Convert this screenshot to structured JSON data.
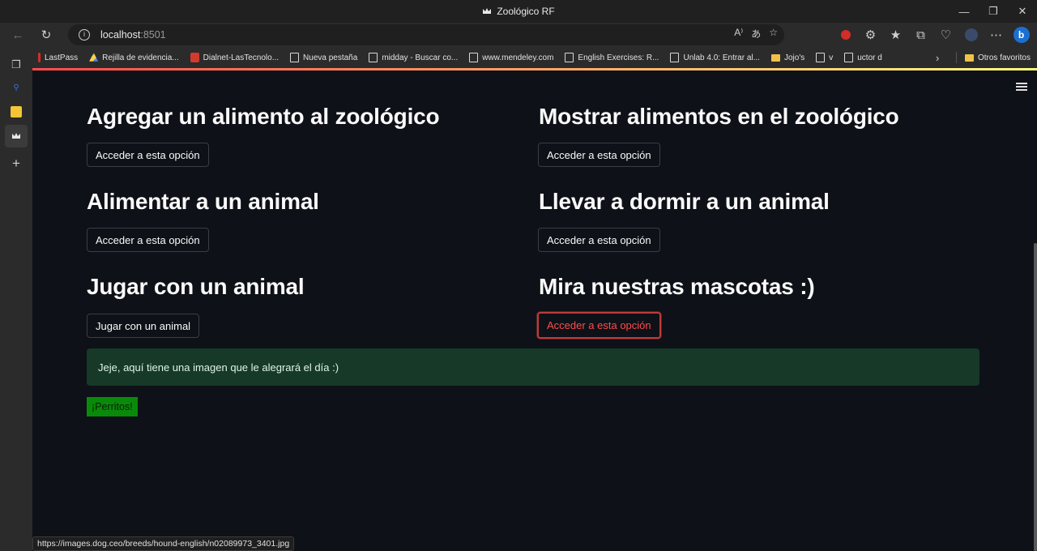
{
  "window": {
    "title": "Zoológico RF"
  },
  "address_bar": {
    "host": "localhost",
    "port": ":8501"
  },
  "bookmarks": [
    {
      "label": "LastPass",
      "icon": "lastpass-icon"
    },
    {
      "label": "Rejilla de evidencia...",
      "icon": "drive-icon"
    },
    {
      "label": "Dialnet-LasTecnolo...",
      "icon": "pdf-icon"
    },
    {
      "label": "Nueva pestaña",
      "icon": "page-icon"
    },
    {
      "label": "midday - Buscar co...",
      "icon": "page-icon"
    },
    {
      "label": "www.mendeley.com",
      "icon": "page-icon"
    },
    {
      "label": "English Exercises: R...",
      "icon": "page-icon"
    },
    {
      "label": "Unlab 4.0: Entrar al...",
      "icon": "page-icon"
    },
    {
      "label": "Jojo's",
      "icon": "folder-icon"
    },
    {
      "label": "v",
      "icon": "page-icon"
    },
    {
      "label": "uctor d",
      "icon": "page-icon"
    }
  ],
  "bookmarks_other": "Otros favoritos",
  "options": [
    {
      "title": "Agregar un alimento al zoológico",
      "button": "Acceder a esta opción"
    },
    {
      "title": "Mostrar alimentos en el zoológico",
      "button": "Acceder a esta opción"
    },
    {
      "title": "Alimentar a un animal",
      "button": "Acceder a esta opción"
    },
    {
      "title": "Llevar a dormir a un animal",
      "button": "Acceder a esta opción"
    },
    {
      "title": "Jugar con un animal",
      "button": "Jugar con un animal"
    },
    {
      "title": "Mira nuestras mascotas :)",
      "button": "Acceder a esta opción"
    }
  ],
  "success_message": "Jeje, aquí tiene una imagen que le alegrará el día :)",
  "tag_label": "¡Perritos!",
  "status_url": "https://images.dog.ceo/breeds/hound-english/n02089973_3401.jpg",
  "colors": {
    "background": "#0e1117",
    "accent": "#ff4b4b",
    "success_bg": "#173928",
    "tag_bg": "#0a8a0a"
  }
}
